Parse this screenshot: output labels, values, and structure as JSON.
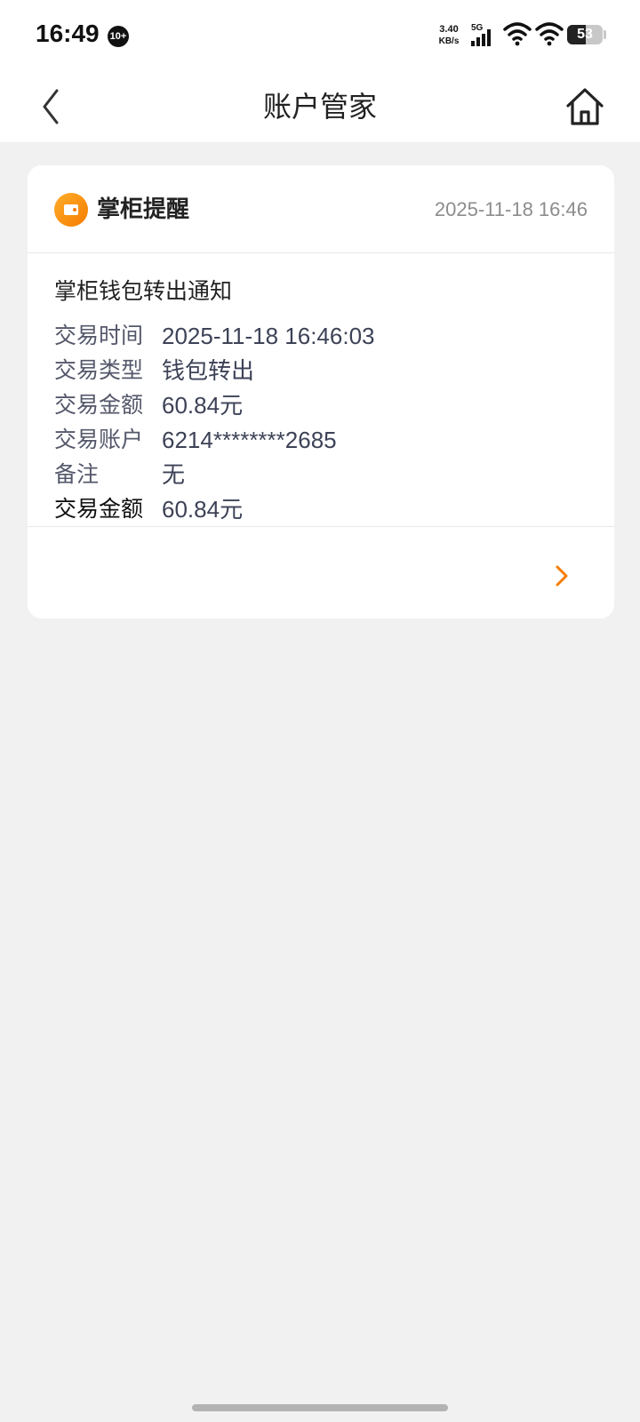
{
  "status_bar": {
    "time": "16:49",
    "notification_badge": "10+",
    "net_speed_value": "3.40",
    "net_speed_unit": "KB/s",
    "network_type": "5G",
    "battery_level": 53,
    "battery_text": "53"
  },
  "nav": {
    "title": "账户管家",
    "back_icon": "chevron-left-icon",
    "home_icon": "home-icon"
  },
  "card": {
    "brand_icon": "wallet-icon",
    "brand_name": "掌柜提醒",
    "time": "2025-11-18 16:46",
    "message_title": "掌柜钱包转出通知",
    "details": [
      {
        "label": "交易时间",
        "value": "2025-11-18 16:46:03"
      },
      {
        "label": "交易类型",
        "value": "钱包转出"
      },
      {
        "label": "交易金额",
        "value": "60.84元"
      },
      {
        "label": "交易账户",
        "value": "6214********2685"
      },
      {
        "label": "备注",
        "value": "无"
      },
      {
        "label": "交易金额",
        "value": "60.84元"
      }
    ],
    "more_icon": "chevron-right-icon",
    "accent_color": "#f57c00"
  }
}
